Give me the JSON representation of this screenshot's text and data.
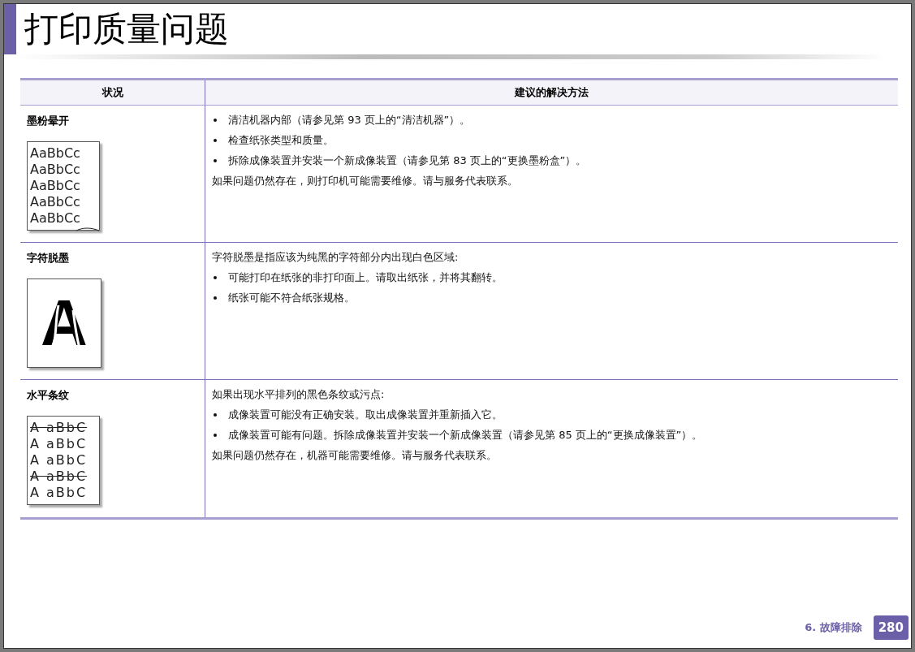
{
  "title": "打印质量问题",
  "table": {
    "columns": [
      "状况",
      "建议的解决方法"
    ],
    "rows": [
      {
        "condition": "墨粉晕开",
        "illustration": {
          "kind": "smear",
          "lines": [
            "AaBbCc",
            "AaBbCc",
            "AaBbCc",
            "AaBbCc",
            "AaBbCc"
          ]
        },
        "solution": [
          {
            "kind": "bullet",
            "text": "清洁机器内部（请参见第 93 页上的“清洁机器”）。"
          },
          {
            "kind": "bullet",
            "text": "检查纸张类型和质量。"
          },
          {
            "kind": "bullet",
            "text": "拆除成像装置并安装一个新成像装置（请参见第 83 页上的“更换墨粉盒”）。"
          },
          {
            "kind": "text",
            "text": "如果问题仍然存在，则打印机可能需要维修。请与服务代表联系。"
          }
        ]
      },
      {
        "condition": "字符脱墨",
        "illustration": {
          "kind": "voids",
          "lines": [
            "A"
          ]
        },
        "solution": [
          {
            "kind": "text",
            "text": "字符脱墨是指应该为纯黑的字符部分内出现白色区域:"
          },
          {
            "kind": "bullet",
            "text": "可能打印在纸张的非打印面上。请取出纸张，并将其翻转。"
          },
          {
            "kind": "bullet",
            "text": "纸张可能不符合纸张规格。"
          }
        ]
      },
      {
        "condition": "水平条纹",
        "illustration": {
          "kind": "streaks",
          "lines": [
            "A aBbC",
            "A aBbC",
            "A aBbC",
            "A aBbC",
            "A aBbC"
          ]
        },
        "solution": [
          {
            "kind": "text",
            "text": "如果出现水平排列的黑色条纹或污点:"
          },
          {
            "kind": "bullet",
            "text": "成像装置可能没有正确安装。取出成像装置并重新插入它。"
          },
          {
            "kind": "bullet",
            "text": "成像装置可能有问题。拆除成像装置并安装一个新成像装置（请参见第 85 页上的“更换成像装置”）。"
          },
          {
            "kind": "text",
            "text": "如果问题仍然存在，机器可能需要维修。请与服务代表联系。"
          }
        ]
      }
    ]
  },
  "footer": {
    "chapter": "6.  故障排除",
    "page": "280"
  }
}
